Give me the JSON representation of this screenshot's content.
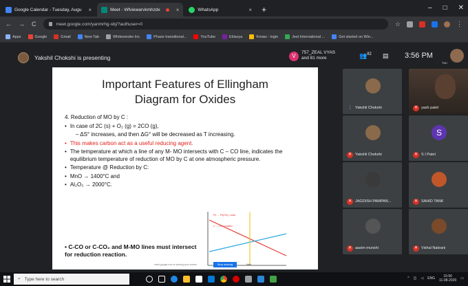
{
  "tabs": [
    {
      "title": "Google Calendar - Tuesday, Augu",
      "favicon_color": "#4285f4",
      "active": false
    },
    {
      "title": "Meet - Wfviewarvkmhzdx",
      "favicon_color": "#00897b",
      "active": true
    },
    {
      "title": "WhatsApp",
      "favicon_color": "#25d366",
      "active": false
    }
  ],
  "tab_close": "×",
  "new_tab": "+",
  "window_controls": {
    "min": "–",
    "max": "□",
    "close": "✕"
  },
  "nav": {
    "back": "←",
    "forward": "→",
    "reload": "C"
  },
  "url": "meet.google.com/yanmrhg-sbj/?authuser=0",
  "bookmarks": [
    {
      "label": "Apps",
      "color": "#8ab4f8"
    },
    {
      "label": "Google",
      "color": "#ea4335"
    },
    {
      "label": "Gmail",
      "color": "#d93025"
    },
    {
      "label": "New Tab",
      "color": "#4285f4"
    },
    {
      "label": "Whitesmoke Inc",
      "color": "#9aa0a6"
    },
    {
      "label": "Phase transitional...",
      "color": "#4285f4"
    },
    {
      "label": "YouTube",
      "color": "#ff0000"
    },
    {
      "label": "Eklavya",
      "color": "#7b1fa2"
    },
    {
      "label": "Kmaw - login",
      "color": "#fbbc04"
    },
    {
      "label": "Jest International ...",
      "color": "#34a853"
    },
    {
      "label": "Get started on Win...",
      "color": "#4285f4"
    }
  ],
  "meet": {
    "presenting_text": "Yakshil Chokshi is presenting",
    "participant_badge": "V",
    "participant_text_1": "757_ZEAL VYAS",
    "participant_text_2": "and 81 more",
    "people_count": "82",
    "time": "3:56 PM",
    "you_label": "You"
  },
  "slide": {
    "title_1": "Important Features of Ellingham",
    "title_2": "Diagram for Oxides",
    "section": "4. Reduction of MO by C :",
    "bullets": [
      {
        "text": "In case of 2C (s) + O₂ (g) = 2CO (g),",
        "style": "normal"
      },
      {
        "text": "– ΔS° increases, and then ΔG° will be decreased as T increasing.",
        "style": "sub"
      },
      {
        "text": "This makes carbon act as a useful reducing agent.",
        "style": "red"
      },
      {
        "text": "The temperature at which a line of any M- MO intersects with C – CO line, indicates the equilibrium temperature of reduction of MO by C at one atmospheric pressure.",
        "style": "normal"
      },
      {
        "text": "Temperature @ Reduction by C:",
        "style": "normal"
      },
      {
        "text": "MnO → 1400°C and",
        "style": "normal"
      },
      {
        "text": "Al₂O₃ → 2000°C.",
        "style": "normal"
      }
    ],
    "footer": "• C-CO or C-CO₂ and M-MO lines must intersect for reduction reaction.",
    "graph_label_top": "Pb → Pb(OH)₂ oxide",
    "graph_label_mid": "C → CO oxidation",
    "graph_caption": "meet.google.com is sharing your screen",
    "share_button": "Stop sharing",
    "dismiss": "Hide"
  },
  "tiles": [
    {
      "name": "Yakshil Chokshi",
      "muted": false,
      "avatar": "photo",
      "color": "#8a6a4a"
    },
    {
      "name": "yash patel",
      "muted": true,
      "avatar": "video",
      "color": "#5a4030"
    },
    {
      "name": "Yakshil Chokshi",
      "muted": true,
      "avatar": "photo",
      "color": "#8a6a4a"
    },
    {
      "name": "S I Patel",
      "muted": true,
      "avatar": "letter",
      "letter": "S",
      "color": "#5e35b1"
    },
    {
      "name": "JAGDISH PAMPAN...",
      "muted": true,
      "avatar": "photo",
      "color": "#3a3a3a"
    },
    {
      "name": "SAHID TANK",
      "muted": true,
      "avatar": "photo",
      "color": "#c0572a"
    },
    {
      "name": "aasim munshi",
      "muted": true,
      "avatar": "photo",
      "color": "#555"
    },
    {
      "name": "Vishal Nakrani",
      "muted": true,
      "avatar": "photo",
      "color": "#7a4a2a"
    }
  ],
  "taskbar": {
    "search_placeholder": "Type here to search",
    "lang": "ENG",
    "time": "15:56",
    "date": "11-08-2020"
  }
}
